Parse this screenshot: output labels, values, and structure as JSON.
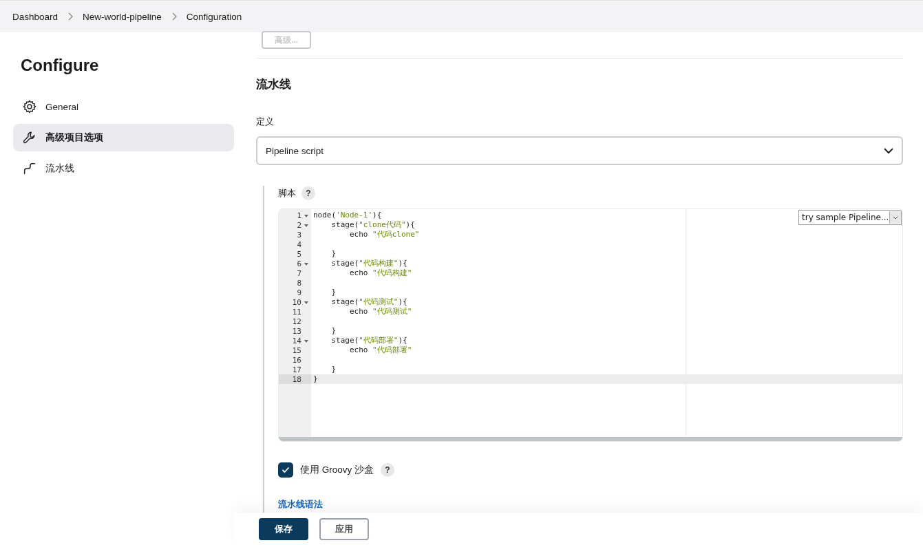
{
  "breadcrumbs": [
    {
      "label": "Dashboard"
    },
    {
      "label": "New-world-pipeline"
    },
    {
      "label": "Configuration"
    }
  ],
  "advanced_button": {
    "label": "高级...",
    "disabled": true
  },
  "sidebar": {
    "title": "Configure",
    "items": [
      {
        "label": "General",
        "kind": "gear",
        "selected": false
      },
      {
        "label": "高级项目选项",
        "kind": "wrench",
        "selected": true
      },
      {
        "label": "流水线",
        "kind": "pipeline",
        "selected": false
      }
    ]
  },
  "section_title": "流水线",
  "definition": {
    "label": "定义",
    "value": "Pipeline script"
  },
  "script": {
    "label": "脚本",
    "help": "?",
    "sample_select": "try sample Pipeline...",
    "lines": [
      {
        "number": "1",
        "foldable": true,
        "active": false,
        "tokens": [
          {
            "kind": "plain",
            "text": "node("
          },
          {
            "kind": "string",
            "text": "'Node-1'"
          },
          {
            "kind": "plain",
            "text": "){"
          }
        ]
      },
      {
        "number": "2",
        "foldable": true,
        "active": false,
        "tokens": [
          {
            "kind": "plain",
            "text": "    stage("
          },
          {
            "kind": "string",
            "text": "\"clone代码\""
          },
          {
            "kind": "plain",
            "text": "){"
          }
        ]
      },
      {
        "number": "3",
        "foldable": false,
        "active": false,
        "tokens": [
          {
            "kind": "plain",
            "text": "        echo "
          },
          {
            "kind": "string",
            "text": "\"代码clone\""
          }
        ]
      },
      {
        "number": "4",
        "foldable": false,
        "active": false
      },
      {
        "number": "5",
        "foldable": false,
        "active": false,
        "tokens": [
          {
            "kind": "plain",
            "text": "    }"
          }
        ]
      },
      {
        "number": "6",
        "foldable": true,
        "active": false,
        "tokens": [
          {
            "kind": "plain",
            "text": "    stage("
          },
          {
            "kind": "string",
            "text": "\"代码构建\""
          },
          {
            "kind": "plain",
            "text": "){"
          }
        ]
      },
      {
        "number": "7",
        "foldable": false,
        "active": false,
        "tokens": [
          {
            "kind": "plain",
            "text": "        echo "
          },
          {
            "kind": "string",
            "text": "\"代码构建\""
          }
        ]
      },
      {
        "number": "8",
        "foldable": false,
        "active": false
      },
      {
        "number": "9",
        "foldable": false,
        "active": false,
        "tokens": [
          {
            "kind": "plain",
            "text": "    }"
          }
        ]
      },
      {
        "number": "10",
        "foldable": true,
        "active": false,
        "tokens": [
          {
            "kind": "plain",
            "text": "    stage("
          },
          {
            "kind": "string",
            "text": "\"代码测试\""
          },
          {
            "kind": "plain",
            "text": "){"
          }
        ]
      },
      {
        "number": "11",
        "foldable": false,
        "active": false,
        "tokens": [
          {
            "kind": "plain",
            "text": "        echo "
          },
          {
            "kind": "string",
            "text": "\"代码测试\""
          }
        ]
      },
      {
        "number": "12",
        "foldable": false,
        "active": false
      },
      {
        "number": "13",
        "foldable": false,
        "active": false,
        "tokens": [
          {
            "kind": "plain",
            "text": "    }"
          }
        ]
      },
      {
        "number": "14",
        "foldable": true,
        "active": false,
        "tokens": [
          {
            "kind": "plain",
            "text": "    stage("
          },
          {
            "kind": "string",
            "text": "\"代码部署\""
          },
          {
            "kind": "plain",
            "text": "){"
          }
        ]
      },
      {
        "number": "15",
        "foldable": false,
        "active": false,
        "tokens": [
          {
            "kind": "plain",
            "text": "        echo "
          },
          {
            "kind": "string",
            "text": "\"代码部署\""
          }
        ]
      },
      {
        "number": "16",
        "foldable": false,
        "active": false
      },
      {
        "number": "17",
        "foldable": false,
        "active": false,
        "tokens": [
          {
            "kind": "plain",
            "text": "    }"
          }
        ]
      },
      {
        "number": "18",
        "foldable": false,
        "active": true,
        "tokens": [
          {
            "kind": "plain",
            "text": "}"
          }
        ]
      }
    ]
  },
  "sandbox": {
    "label": "使用 Groovy 沙盒",
    "checked": true,
    "help": "?"
  },
  "syntax_link": "流水线语法",
  "buttons": [
    {
      "label": "保存",
      "kind": "primary"
    },
    {
      "label": "应用",
      "kind": "secondary"
    }
  ]
}
